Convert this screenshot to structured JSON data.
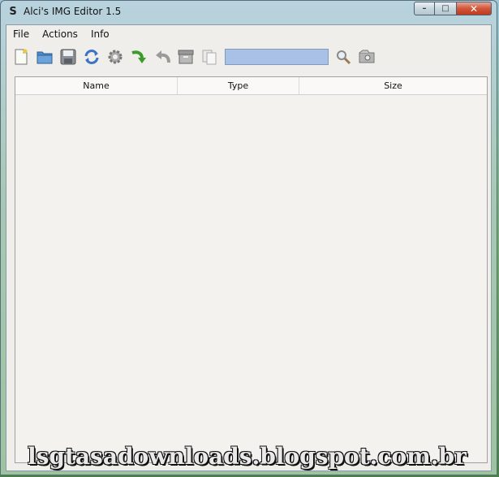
{
  "window": {
    "title": "Alci's IMG Editor 1.5",
    "app_icon": "S",
    "controls": {
      "minimize": "–",
      "maximize": "□",
      "close": "✕"
    }
  },
  "menu": {
    "items": [
      {
        "label": "File"
      },
      {
        "label": "Actions"
      },
      {
        "label": "Info"
      }
    ]
  },
  "toolbar": {
    "icons": [
      "new-file-icon",
      "open-folder-icon",
      "save-icon",
      "refresh-icon",
      "settings-gear-icon",
      "import-arrow-icon",
      "undo-arrow-icon",
      "archive-box-icon",
      "copy-pages-icon"
    ],
    "search": {
      "value": "",
      "placeholder": ""
    },
    "search_icons": [
      "magnifier-icon",
      "find-in-archive-icon"
    ]
  },
  "list": {
    "columns": [
      "Name",
      "Type",
      "Size"
    ],
    "rows": []
  },
  "watermark": {
    "text": "lsgtasadownloads.blogspot.com.br"
  },
  "colors": {
    "accent_green": "#3b9c2c",
    "search_bg": "#a9c1e6",
    "close_red": "#c13a1f"
  }
}
